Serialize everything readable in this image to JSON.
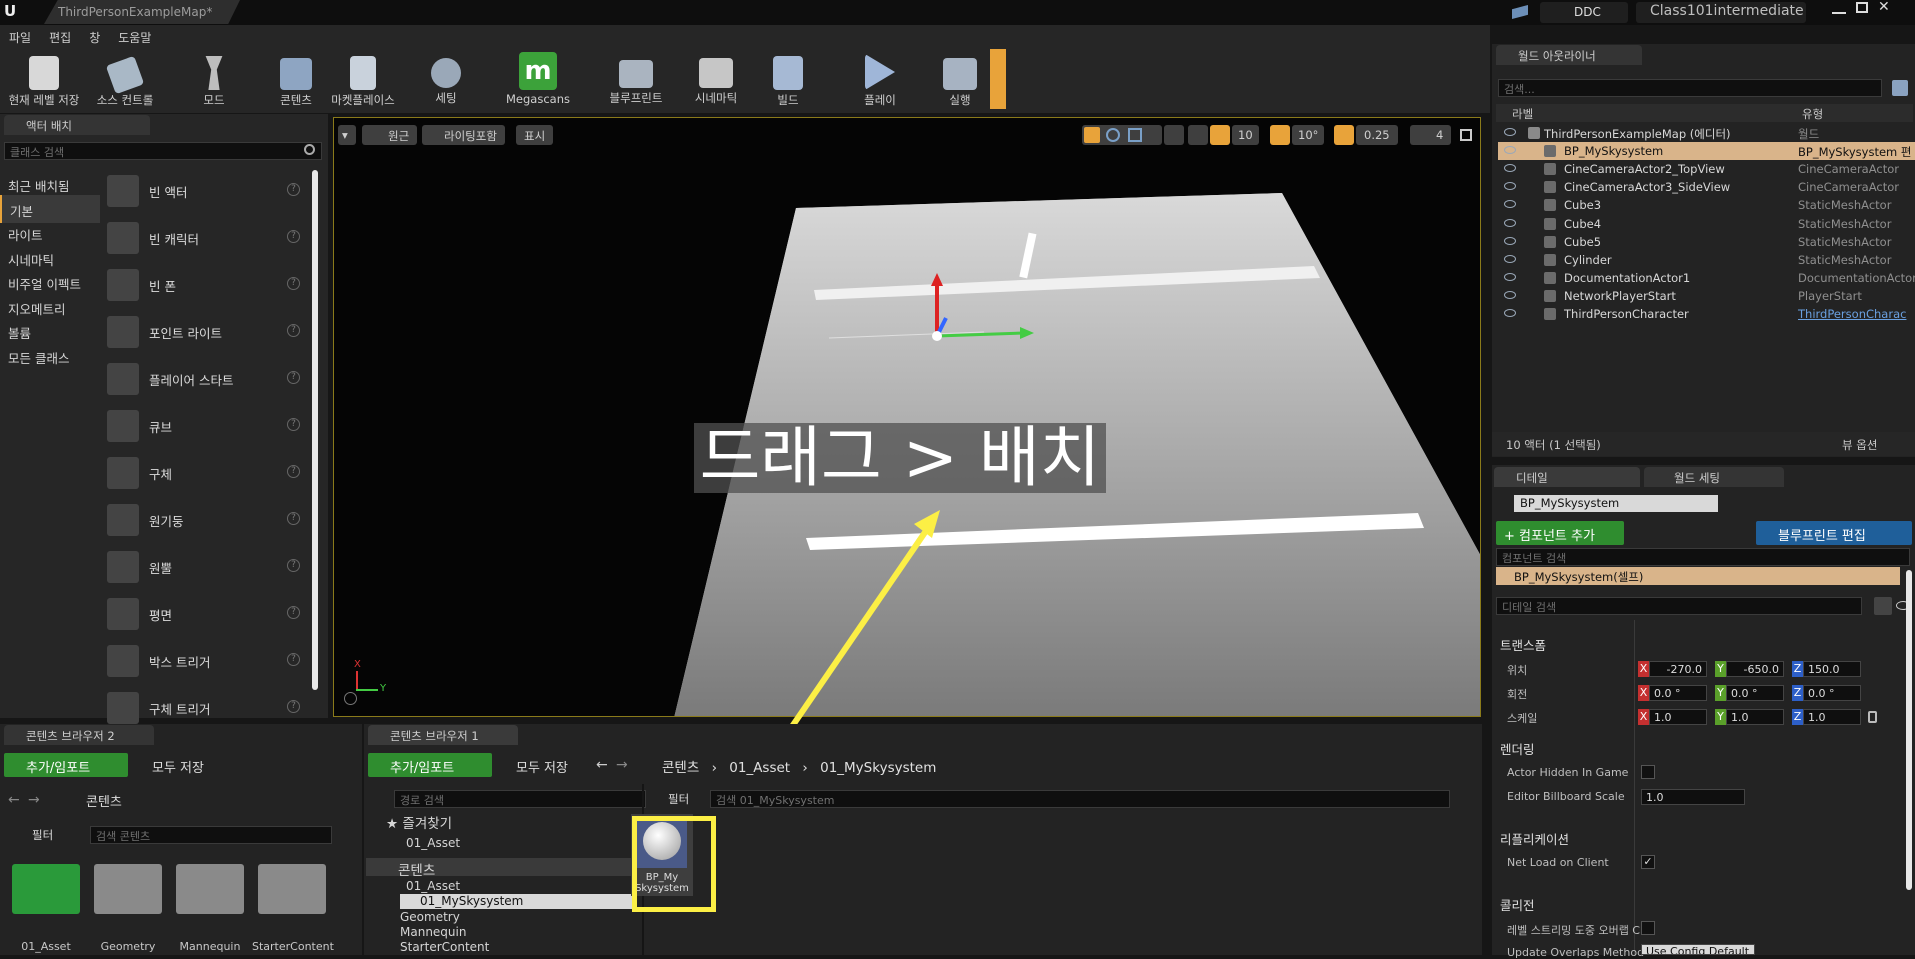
{
  "window": {
    "doc_tab": "ThirdPersonExampleMap*",
    "ddc": "DDC",
    "project": "Class101intermediate"
  },
  "menu": [
    "파일",
    "편집",
    "창",
    "도움말"
  ],
  "toolbar": [
    {
      "label": "현재 레벨 저장",
      "icon": "save-icon"
    },
    {
      "label": "소스 컨트롤",
      "icon": "source-control-icon"
    },
    {
      "label": "모드",
      "icon": "modes-icon"
    },
    {
      "label": "콘텐츠",
      "icon": "content-icon"
    },
    {
      "label": "마켓플레이스",
      "icon": "marketplace-icon"
    },
    {
      "label": "세팅",
      "icon": "settings-icon"
    },
    {
      "label": "Megascans",
      "icon": "megascans-icon"
    },
    {
      "label": "블루프린트",
      "icon": "blueprint-icon"
    },
    {
      "label": "시네마틱",
      "icon": "cinematic-icon"
    },
    {
      "label": "빌드",
      "icon": "build-icon"
    },
    {
      "label": "플레이",
      "icon": "play-icon"
    },
    {
      "label": "실행",
      "icon": "launch-icon"
    }
  ],
  "place_actors": {
    "tab": "액터 배치",
    "search_placeholder": "클래스 검색",
    "categories": [
      "최근 배치됨",
      "기본",
      "라이트",
      "시네마틱",
      "비주얼 이펙트",
      "지오메트리",
      "볼륨",
      "모든 클래스"
    ],
    "selected_category": "기본",
    "items": [
      "빈 액터",
      "빈 캐릭터",
      "빈 폰",
      "포인트 라이트",
      "플레이어 스타트",
      "큐브",
      "구체",
      "원기둥",
      "원뿔",
      "평면",
      "박스 트리거",
      "구체 트리거"
    ]
  },
  "viewport": {
    "buttons": [
      "원근",
      "라이팅포함",
      "표시"
    ],
    "grid_snap": "10",
    "rot_snap": "10°",
    "scale_snap": "0.25",
    "cam_speed": "4",
    "overlay_text": "드래그 > 배치",
    "axis_x": "X",
    "axis_y": "Y"
  },
  "outliner": {
    "tab": "월드 아웃라이너",
    "search_placeholder": "검색...",
    "col_label": "라벨",
    "col_type": "유형",
    "rows": [
      {
        "name": "ThirdPersonExampleMap (에디터)",
        "type": "월드"
      },
      {
        "name": "BP_MySkysystem",
        "type": "BP_MySkysystem 편"
      },
      {
        "name": "CineCameraActor2_TopView",
        "type": "CineCameraActor"
      },
      {
        "name": "CineCameraActor3_SideView",
        "type": "CineCameraActor"
      },
      {
        "name": "Cube3",
        "type": "StaticMeshActor"
      },
      {
        "name": "Cube4",
        "type": "StaticMeshActor"
      },
      {
        "name": "Cube5",
        "type": "StaticMeshActor"
      },
      {
        "name": "Cylinder",
        "type": "StaticMeshActor"
      },
      {
        "name": "DocumentationActor1",
        "type": "DocumentationActor"
      },
      {
        "name": "NetworkPlayerStart",
        "type": "PlayerStart"
      },
      {
        "name": "ThirdPersonCharacter",
        "type": "ThirdPersonCharac"
      }
    ],
    "footer": "10 액터 (1 선택됨)",
    "view_options": "뷰 옵션"
  },
  "details": {
    "tab": "디테일",
    "tab2": "월드 세팅",
    "name_field": "BP_MySkysystem",
    "add_component": "+ 컴포넌트 추가",
    "edit_blueprint": "블루프린트 편집",
    "component_search": "컴포넌트 검색",
    "self_component": "BP_MySkysystem(셀프)",
    "detail_search": "디테일 검색",
    "transform": "트랜스폼",
    "location_label": "위치",
    "rotation_label": "회전",
    "scale_label": "스케일",
    "location": [
      "-270.0",
      "-650.0",
      "150.0"
    ],
    "rotation": [
      "0.0 °",
      "0.0 °",
      "0.0 °"
    ],
    "scale": [
      "1.0",
      "1.0",
      "1.0"
    ],
    "rendering": "렌더링",
    "actor_hidden": "Actor Hidden In Game",
    "billboard_scale_label": "Editor Billboard Scale",
    "billboard_scale": "1.0",
    "replication": "리플리케이션",
    "net_load": "Net Load on Client",
    "collision": "콜리전",
    "level_streaming": "레벨 스트리밍 도중 오버랩 C",
    "update_overlaps": "Update Overlaps Method",
    "update_overlaps_value": "Use Config Default"
  },
  "cb2": {
    "tab": "콘텐츠 브라우저 2",
    "add_import": "추가/임포트",
    "save_all": "모두 저장",
    "path": "콘텐츠",
    "filter": "필터",
    "search_placeholder": "검색 콘텐츠",
    "folders": [
      "01_Asset",
      "Geometry",
      "Mannequin",
      "StarterContent"
    ]
  },
  "cb1": {
    "tab": "콘텐츠 브라우저 1",
    "add_import": "추가/임포트",
    "save_all": "모두 저장",
    "breadcrumb": [
      "콘텐츠",
      "01_Asset",
      "01_MySkysystem"
    ],
    "path_search": "경로 검색",
    "filter": "필터",
    "search_placeholder": "검색 01_MySkysystem",
    "favorites": "즐겨찾기",
    "fav_item": "01_Asset",
    "tree_root": "콘텐츠",
    "tree": [
      "01_Asset",
      "01_MySkysystem",
      "Geometry",
      "Mannequin",
      "StarterContent"
    ],
    "asset": "BP_My Skysystem"
  },
  "colors": {
    "accent": "#e8a33a",
    "highlight": "#fcef45",
    "selected_row": "#d9b48a"
  }
}
